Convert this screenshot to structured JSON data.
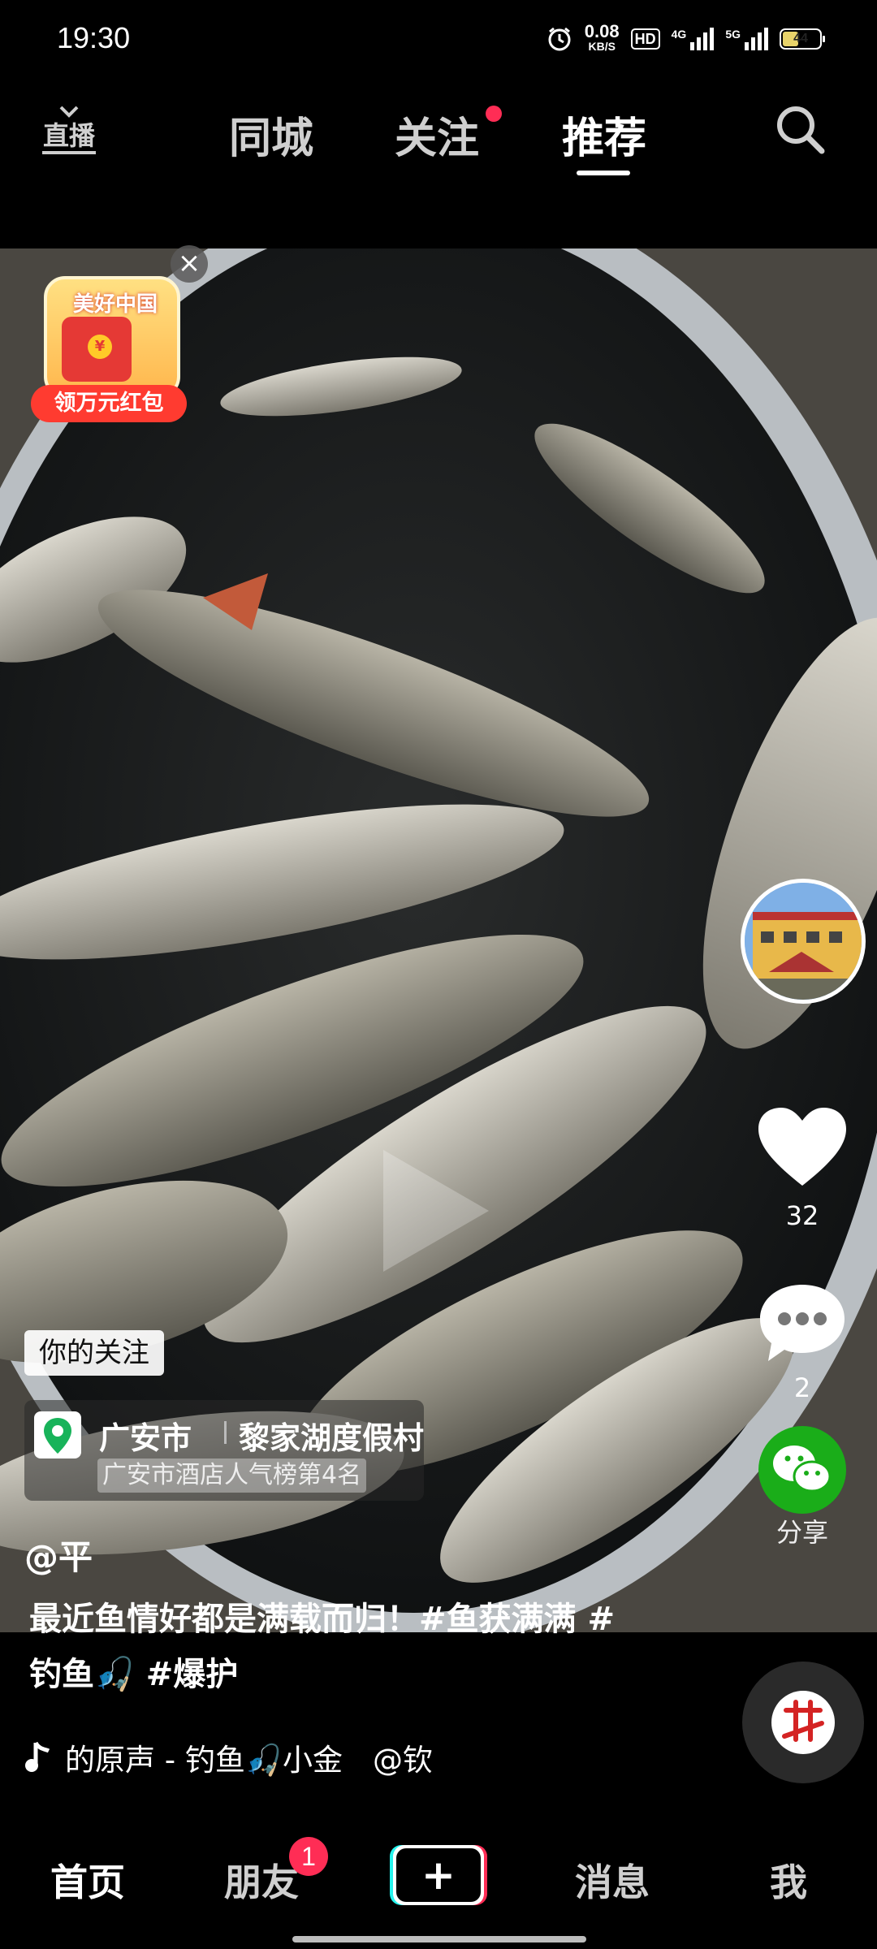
{
  "status_bar": {
    "time": "19:30",
    "speed_value": "0.08",
    "speed_unit": "KB/S",
    "hd_label": "HD",
    "net1_label": "4G",
    "net2_label": "5G",
    "battery": "44",
    "battery_level": 0.44
  },
  "top_nav": {
    "live_label": "直播",
    "tabs": [
      {
        "label": "同城"
      },
      {
        "label": "关注"
      },
      {
        "label": "推荐"
      }
    ],
    "active_tab": "推荐"
  },
  "red_packet": {
    "title": "美好中国",
    "coin": "¥",
    "label": "领万元红包",
    "close": "×"
  },
  "right_rail": {
    "like_count": "32",
    "comment_count": "2",
    "share_label": "分享"
  },
  "overlay": {
    "follow_tag": "你的关注",
    "location_city": "广安市",
    "location_place": "黎家湖度假村",
    "location_rank": "广安市酒店人气榜第4名",
    "author": "@平",
    "caption": "最近鱼情好都是满载而归！#鱼获满满 #钓鱼🎣 #爆护",
    "music": "的原声 - 钓鱼🎣小金　@钦"
  },
  "bottom_nav": {
    "items": [
      {
        "label": "首页"
      },
      {
        "label": "朋友"
      },
      {
        "label": "消息"
      },
      {
        "label": "我"
      }
    ],
    "friends_badge": "1",
    "create_symbol": "+"
  },
  "colors": {
    "accent_red": "#ff2d55",
    "wechat_green": "#1aad19",
    "background": "#000000"
  }
}
